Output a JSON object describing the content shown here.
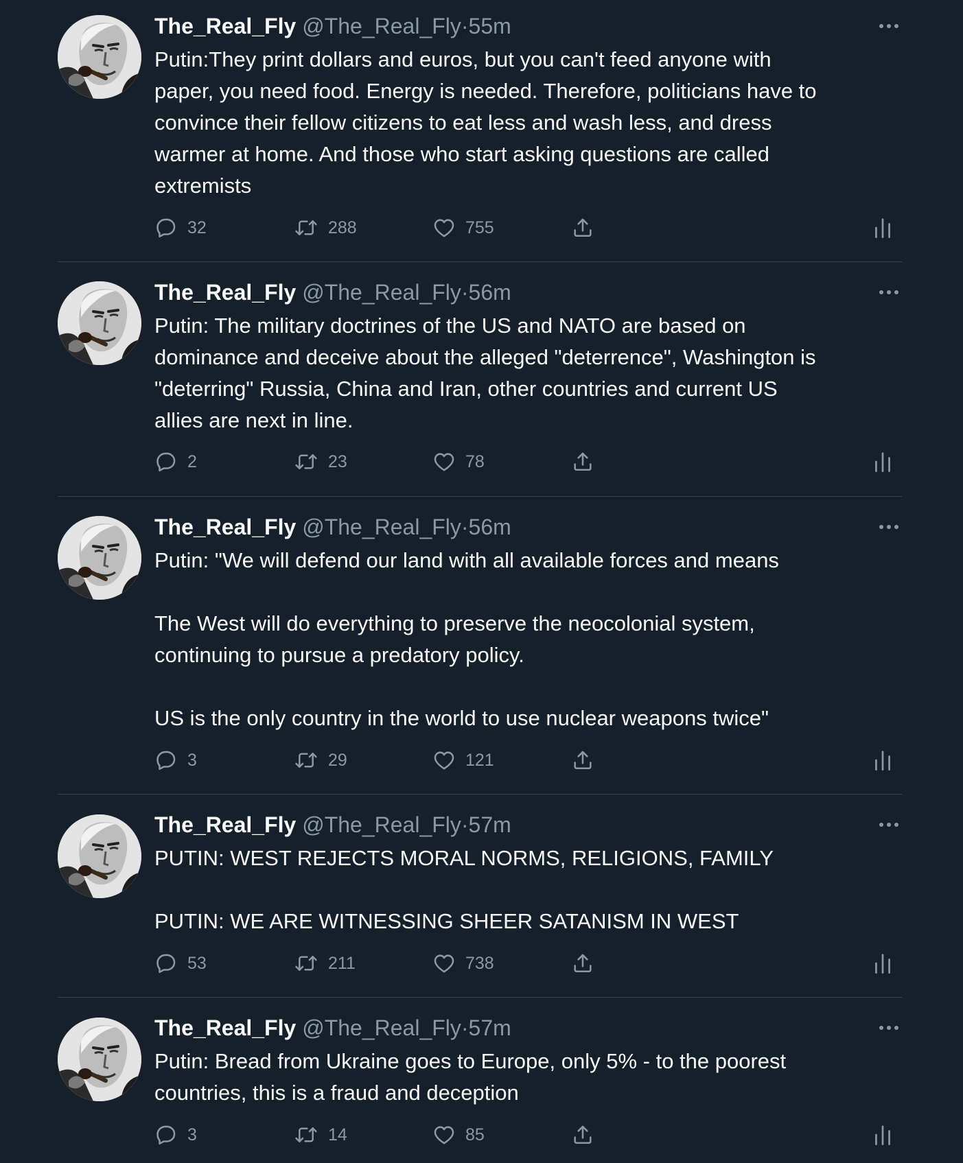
{
  "tweets": [
    {
      "name": "The_Real_Fly",
      "handle": "@The_Real_Fly",
      "separator": "·",
      "time": "55m",
      "paragraphs": [
        "Putin:They print dollars and euros, but you can't feed anyone with\npaper, you need food. Energy is needed. Therefore, politicians have to\nconvince their fellow citizens to eat less and wash less, and dress\nwarmer at home. And those who start asking questions are called\nextremists"
      ],
      "replies": "32",
      "retweets": "288",
      "likes": "755"
    },
    {
      "name": "The_Real_Fly",
      "handle": "@The_Real_Fly",
      "separator": "·",
      "time": "56m",
      "paragraphs": [
        "Putin: The military doctrines of the US and NATO are based on\ndominance and deceive about the alleged \"deterrence\", Washington is\n\"deterring\" Russia, China and Iran, other countries and current US\nallies are next in line."
      ],
      "replies": "2",
      "retweets": "23",
      "likes": "78"
    },
    {
      "name": "The_Real_Fly",
      "handle": "@The_Real_Fly",
      "separator": "·",
      "time": "56m",
      "paragraphs": [
        "Putin: \"We will defend our land with all available forces and means",
        "The West will do everything to preserve the neocolonial system,\ncontinuing to pursue a predatory policy.",
        "US is the only country in the world to use nuclear weapons twice\""
      ],
      "replies": "3",
      "retweets": "29",
      "likes": "121"
    },
    {
      "name": "The_Real_Fly",
      "handle": "@The_Real_Fly",
      "separator": "·",
      "time": "57m",
      "paragraphs": [
        "PUTIN: WEST REJECTS MORAL NORMS, RELIGIONS, FAMILY",
        "PUTIN: WE ARE WITNESSING SHEER SATANISM IN WEST"
      ],
      "replies": "53",
      "retweets": "211",
      "likes": "738"
    },
    {
      "name": "The_Real_Fly",
      "handle": "@The_Real_Fly",
      "separator": "·",
      "time": "57m",
      "paragraphs": [
        "Putin: Bread from Ukraine goes to Europe, only 5% - to the poorest\ncountries, this is a fraud and deception"
      ],
      "replies": "3",
      "retweets": "14",
      "likes": "85"
    }
  ],
  "icons": {
    "avatar": "avatar",
    "more": "more-icon",
    "reply": "reply-icon",
    "retweet": "retweet-icon",
    "like": "like-icon",
    "share": "share-icon",
    "analytics": "analytics-icon"
  },
  "colors": {
    "background": "#15202b",
    "text": "#f7f9f9",
    "muted": "#8b98a5",
    "divider": "#38444d"
  }
}
